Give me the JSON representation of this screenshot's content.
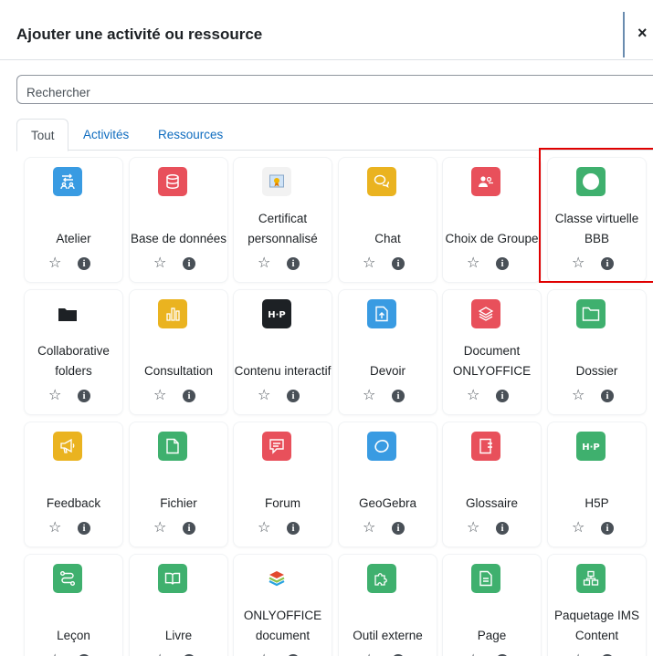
{
  "modal": {
    "title": "Ajouter une activité ou ressource",
    "close_label": "×"
  },
  "search": {
    "placeholder": "Rechercher"
  },
  "tabs": [
    {
      "label": "Tout",
      "active": true
    },
    {
      "label": "Activités",
      "active": false
    },
    {
      "label": "Ressources",
      "active": false
    }
  ],
  "colors": {
    "blue": "#399be2",
    "red": "#e8505b",
    "yellow": "#eab320",
    "green": "#3fb06e",
    "dark": "#1d2125",
    "highlight": "#e00000"
  },
  "items": [
    {
      "label": "Atelier",
      "icon": "people-exchange-icon",
      "color": "#399be2"
    },
    {
      "label": "Base de données",
      "icon": "database-icon",
      "color": "#e8505b"
    },
    {
      "label": "Certificat personnalisé",
      "icon": "certificate-image-icon",
      "color": "#f2f2f2"
    },
    {
      "label": "Chat",
      "icon": "chat-bubbles-icon",
      "color": "#eab320"
    },
    {
      "label": "Choix de Groupe",
      "icon": "group-choice-icon",
      "color": "#e8505b"
    },
    {
      "label": "Classe virtuelle BBB",
      "icon": "circle-icon",
      "color": "#3fb06e"
    },
    {
      "label": "Collaborative folders",
      "icon": "folder-icon",
      "color": "#ffffff"
    },
    {
      "label": "Consultation",
      "icon": "bar-chart-icon",
      "color": "#eab320"
    },
    {
      "label": "Contenu interactif",
      "icon": "h5p-icon",
      "color": "#1d2125"
    },
    {
      "label": "Devoir",
      "icon": "upload-document-icon",
      "color": "#399be2"
    },
    {
      "label": "Document ONLYOFFICE",
      "icon": "layers-icon",
      "color": "#e8505b"
    },
    {
      "label": "Dossier",
      "icon": "folder-outline-icon",
      "color": "#3fb06e"
    },
    {
      "label": "Feedback",
      "icon": "megaphone-icon",
      "color": "#eab320"
    },
    {
      "label": "Fichier",
      "icon": "file-icon",
      "color": "#3fb06e"
    },
    {
      "label": "Forum",
      "icon": "forum-icon",
      "color": "#e8505b"
    },
    {
      "label": "GeoGebra",
      "icon": "geogebra-icon",
      "color": "#399be2"
    },
    {
      "label": "Glossaire",
      "icon": "glossary-icon",
      "color": "#e8505b"
    },
    {
      "label": "H5P",
      "icon": "h5p-icon",
      "color": "#3fb06e"
    },
    {
      "label": "Leçon",
      "icon": "lesson-path-icon",
      "color": "#3fb06e"
    },
    {
      "label": "Livre",
      "icon": "book-icon",
      "color": "#3fb06e"
    },
    {
      "label": "ONLYOFFICE document",
      "icon": "onlyoffice-logo-icon",
      "color": "#ffffff"
    },
    {
      "label": "Outil externe",
      "icon": "puzzle-icon",
      "color": "#3fb06e"
    },
    {
      "label": "Page",
      "icon": "page-icon",
      "color": "#3fb06e"
    },
    {
      "label": "Paquetage IMS Content",
      "icon": "package-icon",
      "color": "#3fb06e"
    }
  ],
  "actions": {
    "star": "☆",
    "info": "i"
  }
}
